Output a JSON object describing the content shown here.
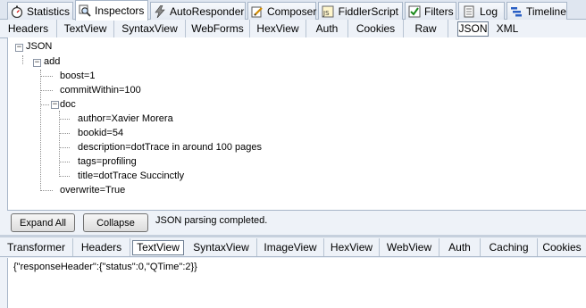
{
  "main_tabs": [
    {
      "label": "Statistics",
      "icon": "stopwatch-icon"
    },
    {
      "label": "Inspectors",
      "icon": "magnifier-icon",
      "active": true
    },
    {
      "label": "AutoResponder",
      "icon": "lightning-icon"
    },
    {
      "label": "Composer",
      "icon": "pencil-icon"
    },
    {
      "label": "FiddlerScript",
      "icon": "script-icon"
    },
    {
      "label": "Filters",
      "icon": "checkbox-icon"
    },
    {
      "label": "Log",
      "icon": "document-icon"
    },
    {
      "label": "Timeline",
      "icon": "timeline-icon"
    }
  ],
  "request_tabs": [
    "Headers",
    "TextView",
    "SyntaxView",
    "WebForms",
    "HexView",
    "Auth",
    "Cookies",
    "Raw",
    "JSON",
    "XML"
  ],
  "request_active_tab": "JSON",
  "tree": {
    "root": "JSON",
    "add": "add",
    "boost": "boost=1",
    "commitWithin": "commitWithin=100",
    "doc": "doc",
    "author": "author=Xavier Morera",
    "bookid": "bookid=54",
    "description": "description=dotTrace in around 100 pages",
    "tags": "tags=profiling",
    "title": "title=dotTrace Succinctly",
    "overwrite": "overwrite=True"
  },
  "buttons": {
    "expand_all": "Expand All",
    "collapse": "Collapse"
  },
  "status": "JSON parsing completed.",
  "response_tabs": [
    "Transformer",
    "Headers",
    "TextView",
    "SyntaxView",
    "ImageView",
    "HexView",
    "WebView",
    "Auth",
    "Caching",
    "Cookies"
  ],
  "response_active_tab": "TextView",
  "response_body": "{\"responseHeader\":{\"status\":0,\"QTime\":2}}"
}
